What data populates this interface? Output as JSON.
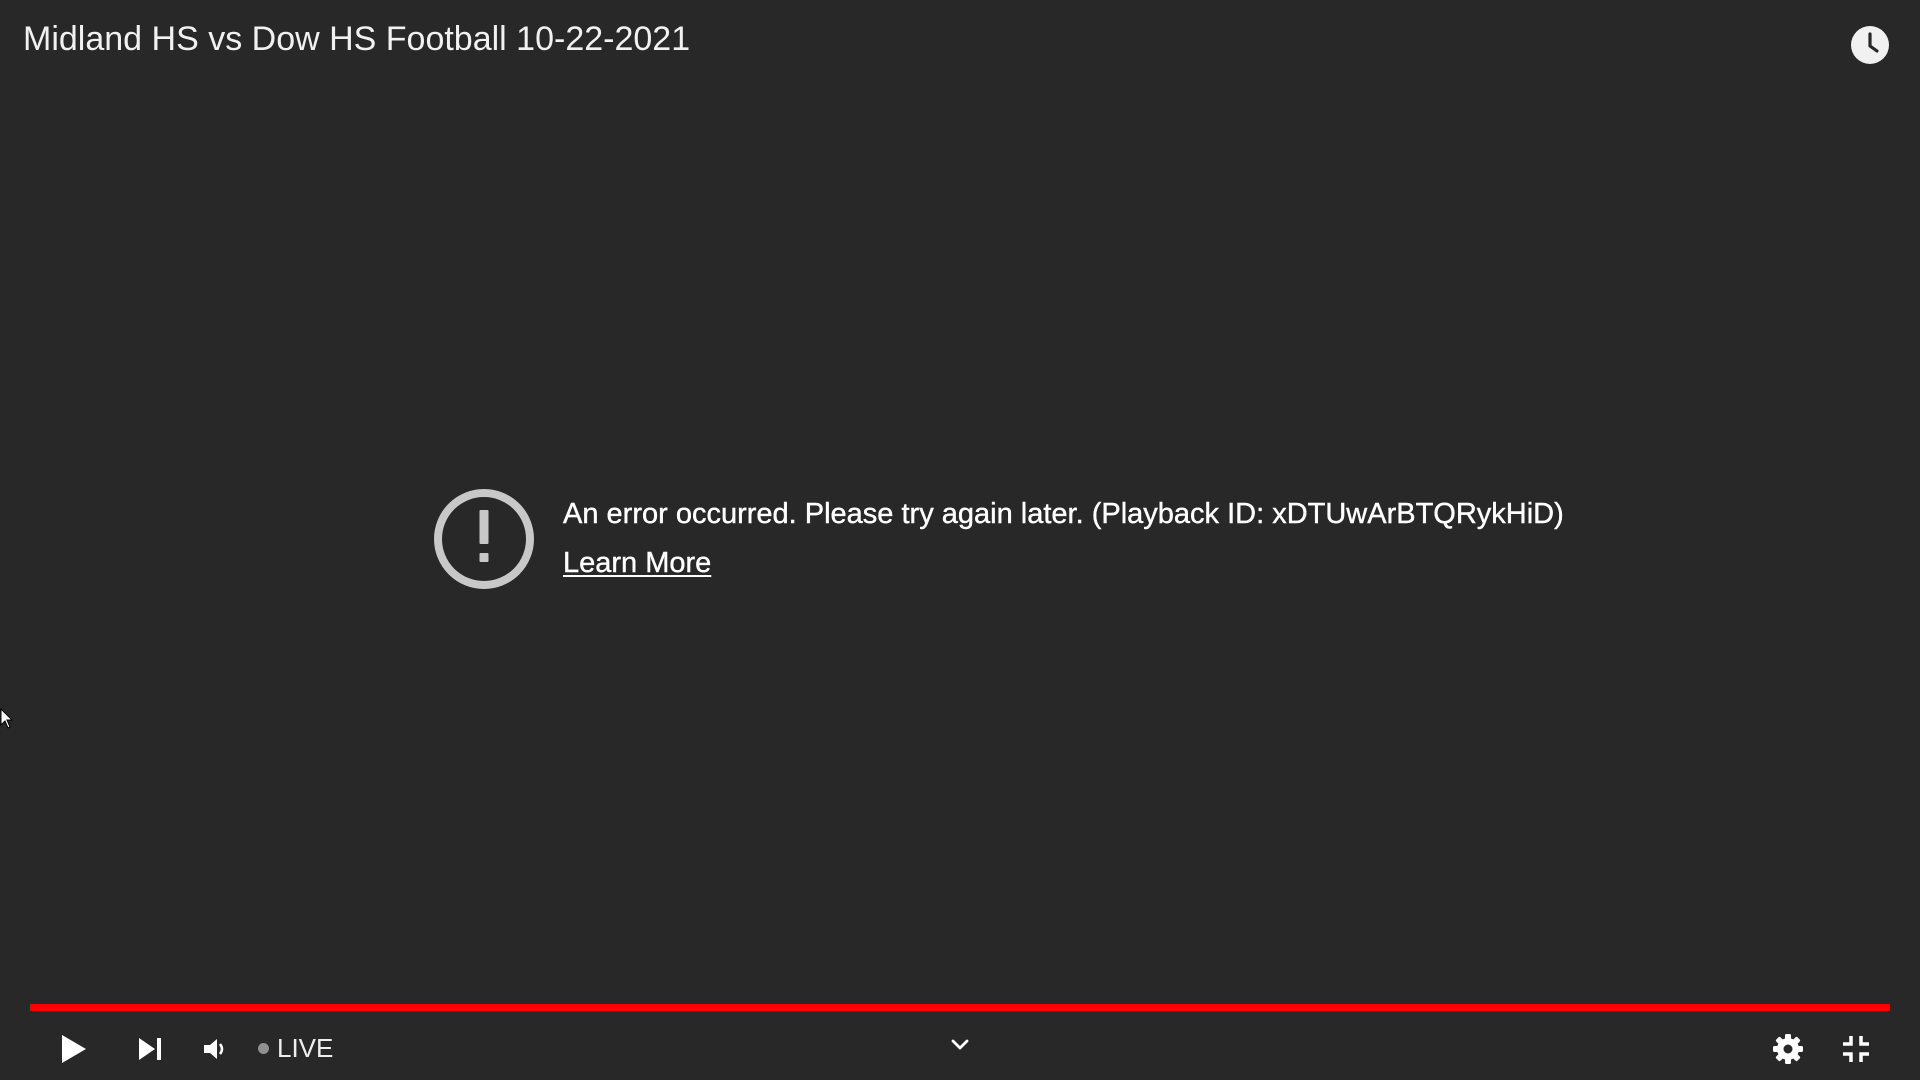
{
  "video": {
    "title": "Midland HS vs Dow HS Football 10-22-2021"
  },
  "error": {
    "message": "An error occurred. Please try again later. (Playback ID: xDTUwArBTQRykHiD)",
    "link_label": "Learn More"
  },
  "controls": {
    "live_label": "LIVE",
    "progress": 1.0
  },
  "icons": {
    "watch_later": "clock-icon",
    "error": "exclamation-circle-icon",
    "play": "play-icon",
    "next": "skip-next-icon",
    "volume": "volume-icon",
    "chevron": "chevron-down-icon",
    "settings": "gear-icon",
    "exit_fullscreen": "exit-fullscreen-icon"
  },
  "colors": {
    "background": "#282828",
    "progress": "#ff0000",
    "text": "#ffffff",
    "error_icon": "#c8c8c8"
  }
}
